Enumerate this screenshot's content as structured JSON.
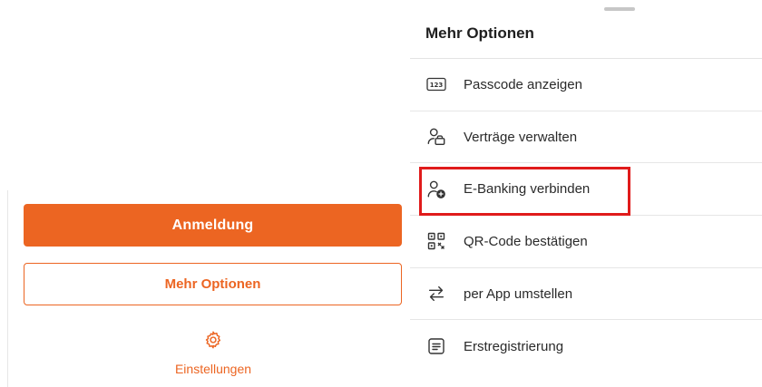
{
  "left": {
    "primary_button": "Anmeldung",
    "secondary_button": "Mehr Optionen",
    "settings_label": "Einstellungen",
    "accent_color": "#ec6522"
  },
  "sheet": {
    "title": "Mehr Optionen",
    "items": [
      {
        "label": "Passcode anzeigen",
        "icon": "passcode-123-icon"
      },
      {
        "label": "Verträge verwalten",
        "icon": "user-card-icon"
      },
      {
        "label": "E-Banking verbinden",
        "icon": "user-plus-icon"
      },
      {
        "label": "QR-Code bestätigen",
        "icon": "qr-code-icon"
      },
      {
        "label": "per App umstellen",
        "icon": "swap-arrows-icon"
      },
      {
        "label": "Erstregistrierung",
        "icon": "form-icon"
      }
    ]
  },
  "highlight_color": "#e01b1b"
}
